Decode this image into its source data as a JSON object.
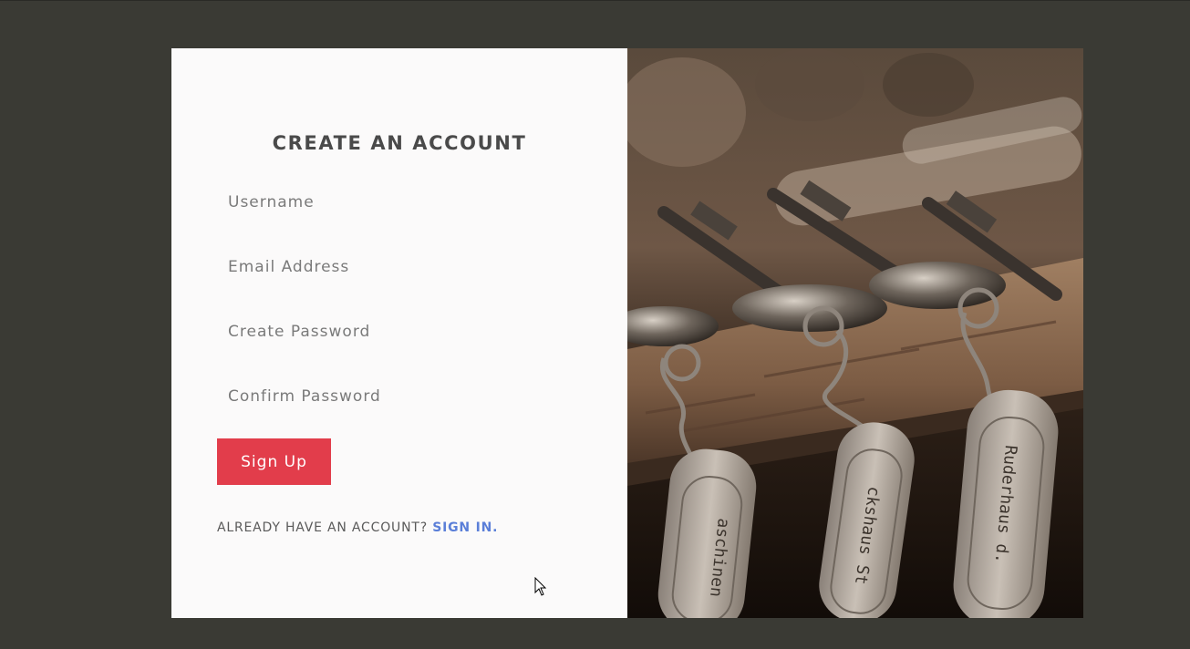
{
  "form": {
    "title": "CREATE AN ACCOUNT",
    "username_placeholder": "Username",
    "email_placeholder": "Email Address",
    "create_password_placeholder": "Create Password",
    "confirm_password_placeholder": "Confirm Password",
    "submit_label": "Sign Up",
    "signin_prompt": "ALREADY HAVE AN ACCOUNT?",
    "signin_link": "SIGN IN."
  },
  "photo": {
    "tag_texts": [
      "aschinen",
      "ckshaus St",
      "Ruderhaus d."
    ]
  },
  "colors": {
    "background": "#3a3a34",
    "panel": "#fbfafa",
    "button": "#e23d4b",
    "link": "#5b7fd8"
  }
}
